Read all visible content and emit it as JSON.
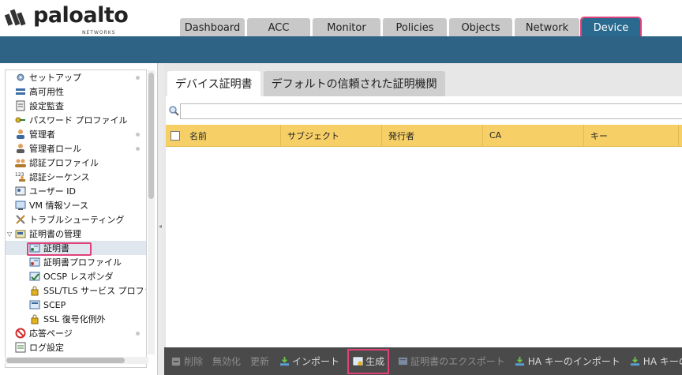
{
  "brand": {
    "name": "paloalto",
    "sub": "NETWORKS"
  },
  "tabs": [
    {
      "label": "Dashboard",
      "width": 82,
      "active": false
    },
    {
      "label": "ACC",
      "width": 80,
      "active": false
    },
    {
      "label": "Monitor",
      "width": 86,
      "active": false
    },
    {
      "label": "Policies",
      "width": 81,
      "active": false
    },
    {
      "label": "Objects",
      "width": 80,
      "active": false
    },
    {
      "label": "Network",
      "width": 82,
      "active": false
    },
    {
      "label": "Device",
      "width": 74,
      "active": true
    }
  ],
  "sidebar": {
    "items": [
      {
        "label": "セットアップ",
        "icon": "gear-icon",
        "dot": true,
        "indent": 0
      },
      {
        "label": "高可用性",
        "icon": "server-icon",
        "dot": false,
        "indent": 0
      },
      {
        "label": "設定監査",
        "icon": "document-icon",
        "dot": false,
        "indent": 0
      },
      {
        "label": "パスワード プロファイル",
        "icon": "key-icon",
        "dot": false,
        "indent": 0
      },
      {
        "label": "管理者",
        "icon": "user-icon",
        "dot": true,
        "indent": 0
      },
      {
        "label": "管理者ロール",
        "icon": "user-role-icon",
        "dot": true,
        "indent": 0
      },
      {
        "label": "認証プロファイル",
        "icon": "users-icon",
        "dot": false,
        "indent": 0
      },
      {
        "label": "認証シーケンス",
        "icon": "sequence-icon",
        "dot": false,
        "indent": 0
      },
      {
        "label": "ユーザー ID",
        "icon": "id-card-icon",
        "dot": false,
        "indent": 0
      },
      {
        "label": "VM 情報ソース",
        "icon": "vm-icon",
        "dot": false,
        "indent": 0
      },
      {
        "label": "トラブルシューティング",
        "icon": "tools-icon",
        "dot": false,
        "indent": 0
      },
      {
        "label": "証明書の管理",
        "icon": "certificate-folder-icon",
        "dot": false,
        "indent": 0,
        "expanded": true
      },
      {
        "label": "証明書",
        "icon": "certificate-icon",
        "dot": false,
        "indent": 1,
        "selected": true
      },
      {
        "label": "証明書プロファイル",
        "icon": "certificate-profile-icon",
        "dot": false,
        "indent": 1
      },
      {
        "label": "OCSP レスポンダ",
        "icon": "ocsp-icon",
        "dot": false,
        "indent": 1
      },
      {
        "label": "SSL/TLS サービス プロファイル",
        "icon": "lock-icon",
        "dot": false,
        "indent": 1
      },
      {
        "label": "SCEP",
        "icon": "scep-icon",
        "dot": false,
        "indent": 1
      },
      {
        "label": "SSL 復号化例外",
        "icon": "lock-icon",
        "dot": false,
        "indent": 1
      },
      {
        "label": "応答ページ",
        "icon": "block-icon",
        "dot": true,
        "indent": 0
      },
      {
        "label": "ログ設定",
        "icon": "log-icon",
        "dot": false,
        "indent": 0
      }
    ]
  },
  "subtabs": [
    {
      "label": "デバイス証明書",
      "active": true
    },
    {
      "label": "デフォルトの信頼された証明機関",
      "active": false
    }
  ],
  "search": {
    "placeholder": ""
  },
  "table": {
    "columns": [
      {
        "label": "名前",
        "width": 124
      },
      {
        "label": "サブジェクト",
        "width": 128
      },
      {
        "label": "発行者",
        "width": 128
      },
      {
        "label": "CA",
        "width": 128
      },
      {
        "label": "キー",
        "width": 120
      }
    ]
  },
  "toolbar": {
    "items": [
      {
        "label": "削除",
        "icon": "minus-icon",
        "disabled": true,
        "name": "delete-button"
      },
      {
        "label": "無効化",
        "icon": "",
        "disabled": true,
        "name": "revoke-button"
      },
      {
        "label": "更新",
        "icon": "",
        "disabled": true,
        "name": "renew-button"
      },
      {
        "label": "インポート",
        "icon": "import-icon",
        "disabled": false,
        "name": "import-button"
      },
      {
        "label": "生成",
        "icon": "generate-certificate-icon",
        "disabled": false,
        "name": "generate-button",
        "highlight": true
      },
      {
        "label": "証明書のエクスポート",
        "icon": "export-icon",
        "disabled": true,
        "name": "export-certificate-button"
      },
      {
        "label": "HA キーのインポート",
        "icon": "import-icon",
        "disabled": false,
        "name": "import-ha-key-button"
      },
      {
        "label": "HA キーのエクスポート",
        "icon": "import-icon",
        "disabled": false,
        "name": "export-ha-key-button"
      }
    ]
  },
  "colors": {
    "accent_blue": "#2f6386",
    "active_tab": "#2b6a8f",
    "highlight": "#e0417a",
    "table_header": "#f6d067"
  }
}
